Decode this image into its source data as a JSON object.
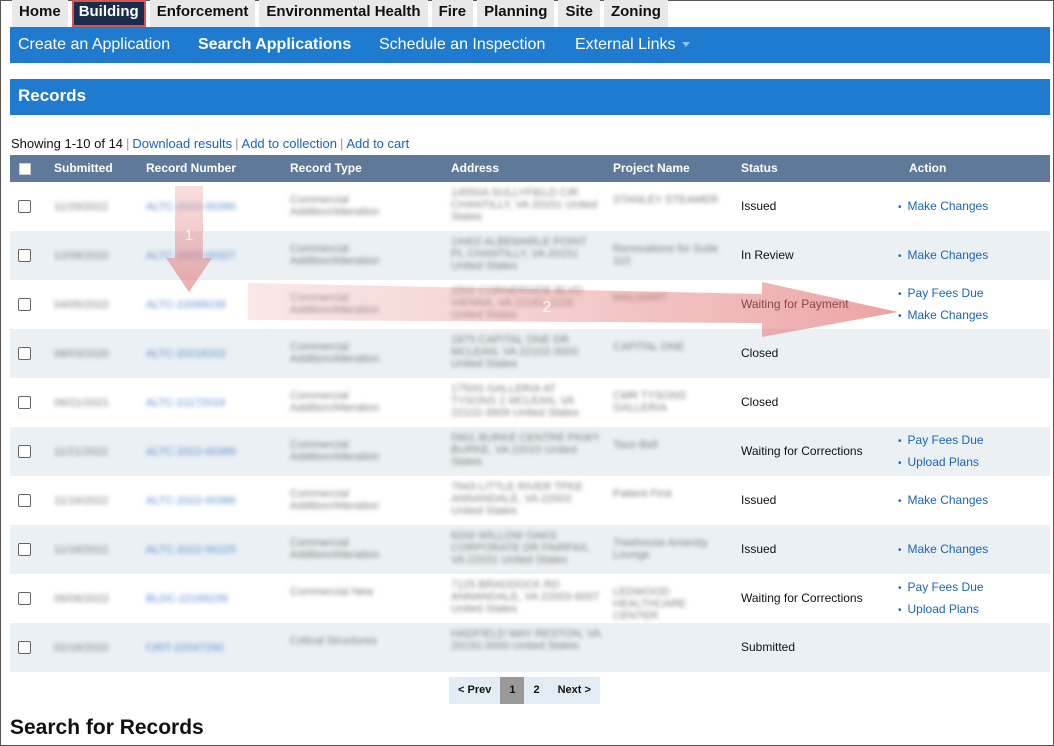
{
  "tabs": [
    "Home",
    "Building",
    "Enforcement",
    "Environmental Health",
    "Fire",
    "Planning",
    "Site",
    "Zoning"
  ],
  "active_tab": "Building",
  "nav": {
    "create": "Create an Application",
    "search": "Search Applications",
    "schedule": "Schedule an Inspection",
    "external": "External Links"
  },
  "records_title": "Records",
  "showing": {
    "text": "Showing 1-10 of 14",
    "download": "Download results",
    "collection": "Add to collection",
    "cart": "Add to cart"
  },
  "columns": [
    "Submitted",
    "Record Number",
    "Record Type",
    "Address",
    "Project Name",
    "Status",
    "Action"
  ],
  "rows": [
    {
      "submitted": "11/29/2022",
      "record": "ALTC-2022-00390",
      "type": "Commercial Addition/Alteration",
      "address": "14550A SULLYFIELD CIR CHANTILLY, VA 20151 United States",
      "project": "STANLEY STEAMER",
      "status": "Issued",
      "actions": [
        "Make Changes"
      ]
    },
    {
      "submitted": "12/08/2022",
      "record": "ALTC-2022-00327",
      "type": "Commercial Addition/Alteration",
      "address": "14402 ALBEMARLE POINT PL CHANTILLY, VA 20151 United States",
      "project": "Renovations for Suite 110",
      "status": "In Review",
      "actions": [
        "Make Changes"
      ]
    },
    {
      "submitted": "04/05/2022",
      "record": "ALTC-22069239",
      "type": "Commercial Addition/Alteration",
      "address": "1500 CORNERSIDE BLVD VIENNA, VA 22182-2226 United States",
      "project": "WALMART",
      "status": "Waiting for Payment",
      "actions": [
        "Pay Fees Due",
        "Make Changes"
      ]
    },
    {
      "submitted": "08/03/2020",
      "record": "ALTC-20218202",
      "type": "Commercial Addition/Alteration",
      "address": "1875 CAPITAL ONE DR MCLEAN, VA 22102-3000 United States",
      "project": "CAPITAL ONE",
      "status": "Closed",
      "actions": []
    },
    {
      "submitted": "06/21/2021",
      "record": "ALTC-21172019",
      "type": "Commercial Addition/Alteration",
      "address": "1750G GALLERIA AT TYSONS 2 MCLEAN, VA 22102-3909 United States",
      "project": "CMR TYSONS GALLERIA",
      "status": "Closed",
      "actions": []
    },
    {
      "submitted": "11/21/2022",
      "record": "ALTC-2022-00389",
      "type": "Commercial Addition/Alteration",
      "address": "5901 BURKE CENTRE PKWY BURKE, VA 22015 United States",
      "project": "Taco Bell",
      "status": "Waiting for Corrections",
      "actions": [
        "Pay Fees Due",
        "Upload Plans"
      ]
    },
    {
      "submitted": "11/16/2022",
      "record": "ALTC-2022-00386",
      "type": "Commercial Addition/Alteration",
      "address": "7943 LITTLE RIVER TPKE ANNANDALE, VA 22003 United States",
      "project": "Patient First",
      "status": "Issued",
      "actions": [
        "Make Changes"
      ]
    },
    {
      "submitted": "11/16/2022",
      "record": "ALTC-2022-00225",
      "type": "Commercial Addition/Alteration",
      "address": "8200 WILLOW OAKS CORPORATE DR FAIRFAX, VA 22031 United States",
      "project": "Treehouse Amenity Lounge",
      "status": "Issued",
      "actions": [
        "Make Changes"
      ]
    },
    {
      "submitted": "06/06/2022",
      "record": "BLDC-22169239",
      "type": "Commercial New",
      "address": "7125 BRADDOCK RD ANNANDALE, VA 22003-6007 United States",
      "project": "LEDWOOD HEALTHCARE CENTER",
      "status": "Waiting for Corrections",
      "actions": [
        "Pay Fees Due",
        "Upload Plans"
      ]
    },
    {
      "submitted": "02/16/2022",
      "record": "CRIT-22047290",
      "type": "Critical Structures",
      "address": "HADFIELD WAY RESTON, VA 20191-0000 United States",
      "project": "",
      "status": "Submitted",
      "actions": []
    }
  ],
  "annotations": [
    "1",
    "2"
  ],
  "pager": {
    "prev": "< Prev",
    "page1": "1",
    "page2": "2",
    "next": "Next >"
  },
  "search_title": "Search for Records"
}
